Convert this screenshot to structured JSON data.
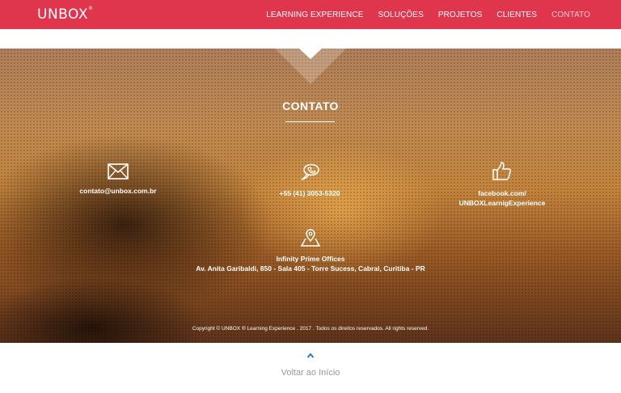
{
  "header": {
    "logo": "UNBOX",
    "logo_mark": "®",
    "nav": [
      {
        "label": "LEARNING EXPERIENCE"
      },
      {
        "label": "SOLUÇÕES"
      },
      {
        "label": "PROJETOS"
      },
      {
        "label": "CLIENTES"
      },
      {
        "label": "CONTATO"
      }
    ],
    "active_item": "CONTATO"
  },
  "contact": {
    "title": "CONTATO",
    "email": {
      "icon": "envelope-icon",
      "text": "contato@unbox.com.br"
    },
    "phone": {
      "icon": "phone-bubble-icon",
      "text": "+55 (41) 3053-5320"
    },
    "social": {
      "icon": "thumbs-up-icon",
      "line1": "facebook.com/",
      "line2": "UNBOXLearnigExperience"
    },
    "address": {
      "icon": "map-pin-icon",
      "line1": "Infinity Prime Offices",
      "line2": "Av. Anita Garibaldi, 850 - Sala 405 - Torre Sucess, Cabral, Curitiba - PR"
    },
    "copyright": "Copyright ©  UNBOX ® Learning Experience  .  2017  .  Todos os direitos reservados. All rights reserved."
  },
  "footer": {
    "back_icon": "chevron-up-icon",
    "back_label": "Voltar ao Início"
  },
  "colors": {
    "header_bg": "#e0364d",
    "active_nav": "#f7c9cf",
    "back_icon": "#2f77b8",
    "back_label": "#9a9a9a"
  }
}
